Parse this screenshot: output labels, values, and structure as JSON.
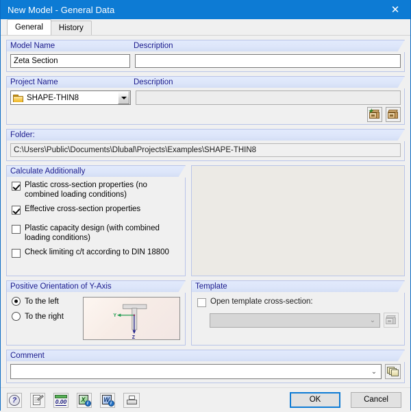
{
  "window": {
    "title": "New Model - General Data",
    "close_icon": "close-icon"
  },
  "tabs": [
    {
      "label": "General",
      "active": true
    },
    {
      "label": "History",
      "active": false
    }
  ],
  "model": {
    "name_label": "Model Name",
    "description_label": "Description",
    "name_value": "Zeta Section",
    "description_value": ""
  },
  "project": {
    "name_label": "Project Name",
    "description_label": "Description",
    "name_value": "SHAPE-THIN8",
    "description_value": "",
    "folder_icon": "folder-icon",
    "dropdown_icon": "chevron-down-icon",
    "new_project_button_icon": "new-project-box-icon",
    "select_project_button_icon": "project-box-icon"
  },
  "folder": {
    "label": "Folder:",
    "path": "C:\\Users\\Public\\Documents\\Dlubal\\Projects\\Examples\\SHAPE-THIN8"
  },
  "calculate": {
    "group_label": "Calculate Additionally",
    "options": [
      {
        "label": "Plastic cross-section properties (no combined loading conditions)",
        "checked": true
      },
      {
        "label": "Effective cross-section properties",
        "checked": true
      },
      {
        "label": "Plastic capacity design (with combined loading conditions)",
        "checked": false
      },
      {
        "label": "Check limiting c/t according to DIN 18800",
        "checked": false
      }
    ]
  },
  "orientation": {
    "group_label": "Positive Orientation of Y-Axis",
    "options": [
      {
        "label": "To the left",
        "selected": true
      },
      {
        "label": "To the right",
        "selected": false
      }
    ],
    "preview": {
      "y_axis_label": "Y",
      "z_axis_label": "Z",
      "y_axis_color": "#1f9b4f",
      "z_axis_color": "#232389",
      "shape": "T-section"
    }
  },
  "template": {
    "group_label": "Template",
    "checkbox_label": "Open template cross-section:",
    "checked": false,
    "combo_value": "",
    "combo_icon": "chevron-down-icon",
    "browse_button_icon": "template-box-icon"
  },
  "comment": {
    "group_label": "Comment",
    "value": "",
    "dropdown_icon": "chevron-down-icon",
    "library_button_icon": "comment-library-icon"
  },
  "toolbar": {
    "buttons": [
      {
        "name": "help-button",
        "icon": "help-icon",
        "glyph": "?"
      },
      {
        "name": "edit-notes-button",
        "icon": "note-edit-icon",
        "glyph": ""
      },
      {
        "name": "units-button",
        "icon": "units-decimal-icon",
        "glyph": "0.00"
      },
      {
        "name": "export-excel-button",
        "icon": "excel-export-icon",
        "glyph": "X"
      },
      {
        "name": "export-word-button",
        "icon": "word-export-icon",
        "glyph": "W"
      },
      {
        "name": "printout-report-button",
        "icon": "printout-report-icon",
        "glyph": ""
      }
    ]
  },
  "actions": {
    "ok_label": "OK",
    "cancel_label": "Cancel"
  },
  "colors": {
    "titlebar": "#0d7bd4",
    "group_header_text": "#19198c",
    "accent_focus": "#0d7bd4"
  }
}
